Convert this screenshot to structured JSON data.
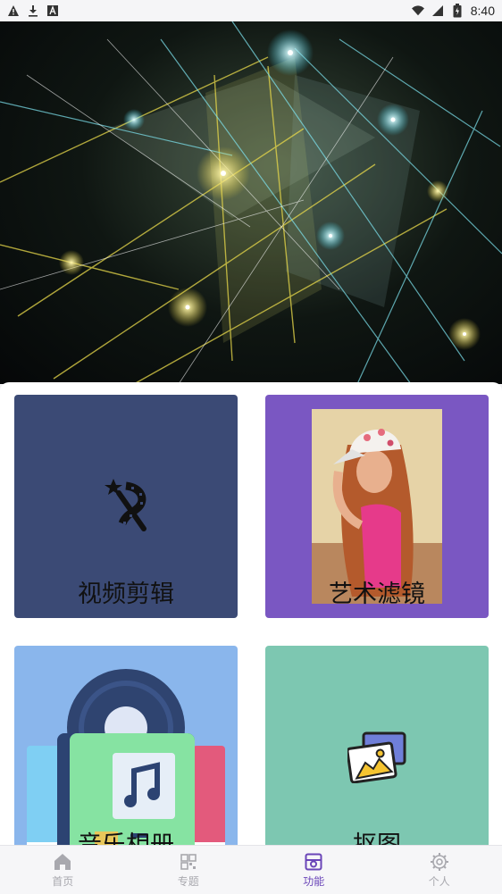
{
  "status_bar": {
    "time": "8:40",
    "left_icons": [
      "warning-icon",
      "download-icon",
      "font-icon"
    ],
    "right_icons": [
      "signal-icon",
      "wifi-icon",
      "battery-icon"
    ]
  },
  "hero": {
    "icon": "abstract-light-grid-image"
  },
  "cards": [
    {
      "label": "视频剪辑",
      "color": "#3b4a75",
      "icon": "magic-wand-film-icon"
    },
    {
      "label": "艺术滤镜",
      "color": "#7a57c2",
      "icon": "portrait-photo"
    },
    {
      "label": "音乐相册",
      "color": "#8ab6ec",
      "icon": "music-album-icon"
    },
    {
      "label": "抠图",
      "color": "#7dc7b1",
      "icon": "image-cutout-icon"
    }
  ],
  "bottom_nav": {
    "active_color": "#6a45b8",
    "items": [
      {
        "label": "首页",
        "icon": "home-icon"
      },
      {
        "label": "专题",
        "icon": "grid-icon"
      },
      {
        "label": "功能",
        "icon": "function-icon"
      },
      {
        "label": "个人",
        "icon": "gear-icon"
      }
    ]
  }
}
